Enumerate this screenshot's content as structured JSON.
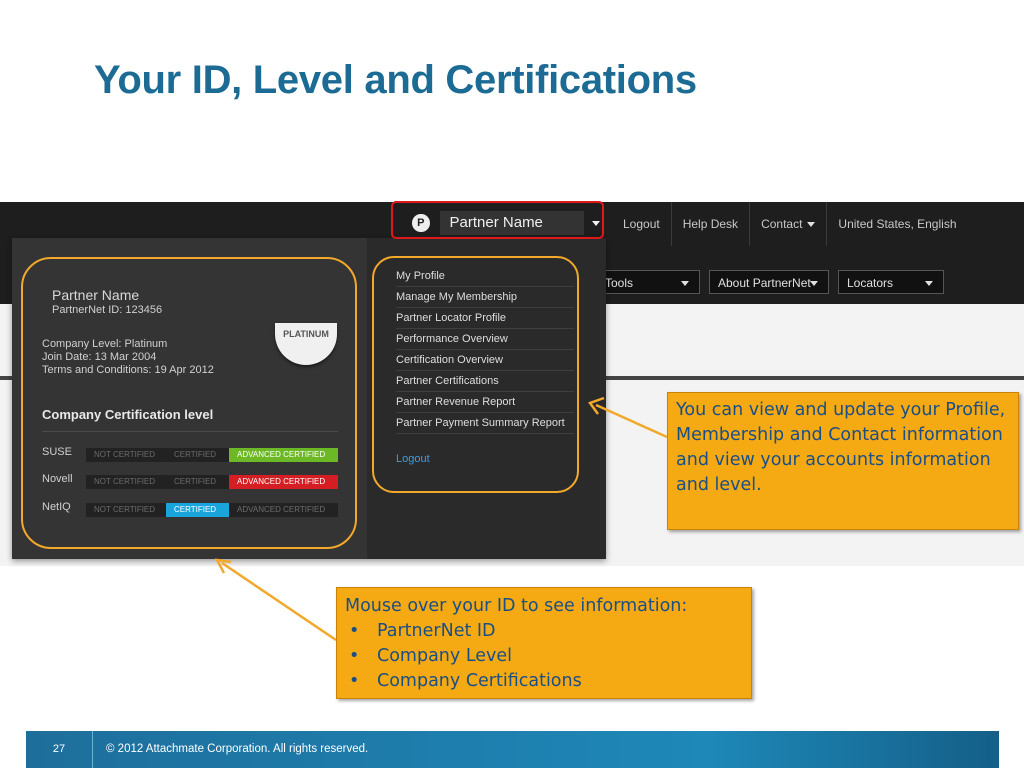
{
  "slide": {
    "title": "Your ID, Level and Certifications",
    "page_number": "27",
    "copyright": "© 2012 Attachmate Corporation.  All rights reserved."
  },
  "header": {
    "partner_badge": "P",
    "partner_name": "Partner Name",
    "top_links": [
      "Logout",
      "Help Desk",
      "Contact",
      "United States, English"
    ],
    "nav_buttons": [
      "Tools",
      "About PartnerNet",
      "Locators"
    ]
  },
  "profile_card": {
    "name": "Partner Name",
    "partnernet_id": "PartnerNet ID: 123456",
    "level_badge": "PLATINUM",
    "company_level": "Company Level: Platinum",
    "join_date": "Join Date: 13 Mar 2004",
    "terms": "Terms and Conditions: 19 Apr 2012",
    "cert_heading": "Company Certification level",
    "cert_states": [
      "NOT CERTIFIED",
      "CERTIFIED",
      "ADVANCED CERTIFIED"
    ],
    "certifications": [
      {
        "vendor": "SUSE",
        "status": "ADVANCED CERTIFIED",
        "color": "#6cb825"
      },
      {
        "vendor": "Novell",
        "status": "ADVANCED CERTIFIED",
        "color": "#d41e24"
      },
      {
        "vendor": "NetIQ",
        "status": "CERTIFIED",
        "color": "#1aa4dc"
      }
    ]
  },
  "menu": {
    "items": [
      "My Profile",
      "Manage My Membership",
      "Partner Locator Profile",
      "Performance Overview",
      "Certification Overview",
      "Partner Certifications",
      "Partner Revenue Report",
      "Partner Payment Summary Report"
    ],
    "logout": "Logout"
  },
  "callouts": {
    "profile": "You can view and update your Profile, Membership and Contact information and view your accounts information and level.",
    "mouse_over": "Mouse over your ID to see information:",
    "bullets": [
      "PartnerNet ID",
      "Company Level",
      "Company Certifications"
    ]
  },
  "colors": {
    "title": "#1c6b94",
    "highlight_red": "#e0181c",
    "frame_orange": "#f2a82b",
    "callout_fill": "#f5a913",
    "callout_text": "#1a4f86"
  }
}
